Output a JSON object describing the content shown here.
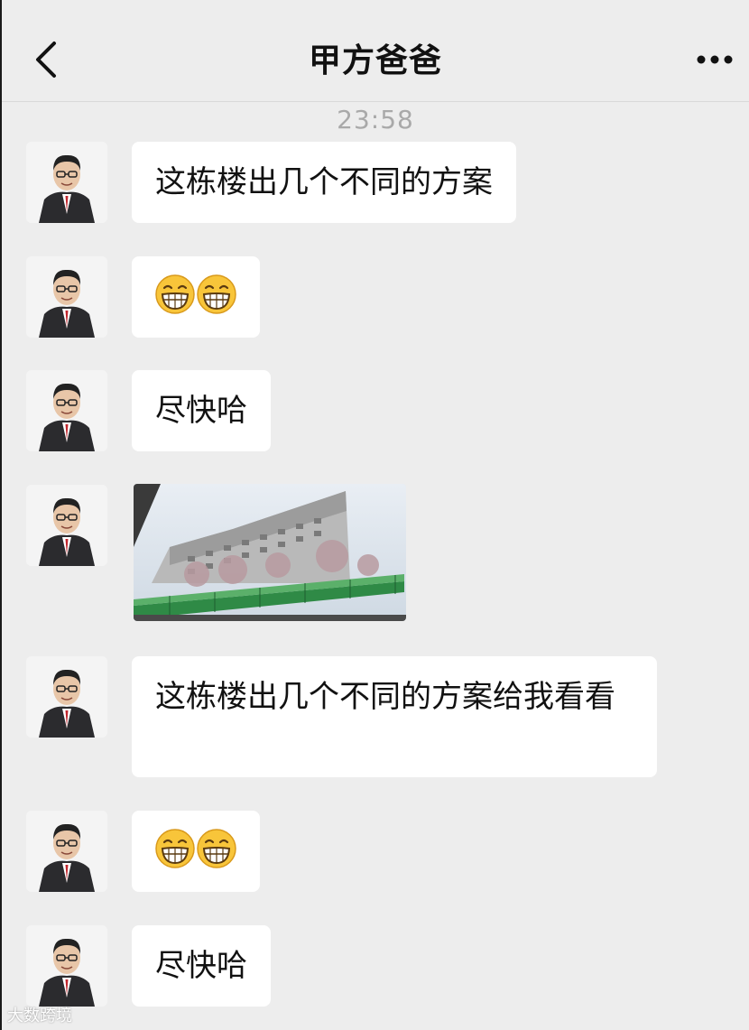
{
  "header": {
    "title": "甲方爸爸",
    "back_icon": "chevron-left-icon",
    "more_icon": "more-dots-icon"
  },
  "timestamp": "23:58",
  "messages": [
    {
      "type": "text",
      "text": "这栋楼出几个不同的方案"
    },
    {
      "type": "emoji",
      "emoji": [
        "grin-icon",
        "grin-icon"
      ]
    },
    {
      "type": "text",
      "text": "尽快哈"
    },
    {
      "type": "image",
      "alt": "building-photo"
    },
    {
      "type": "text",
      "text": "这栋楼出几个不同的方案给我看看"
    },
    {
      "type": "emoji",
      "emoji": [
        "grin-icon",
        "grin-icon"
      ]
    },
    {
      "type": "text",
      "text": "尽快哈"
    }
  ],
  "watermark": "大数跨境",
  "colors": {
    "background": "#ededed",
    "bubble": "#ffffff",
    "timestamp": "#a9a9a9"
  }
}
